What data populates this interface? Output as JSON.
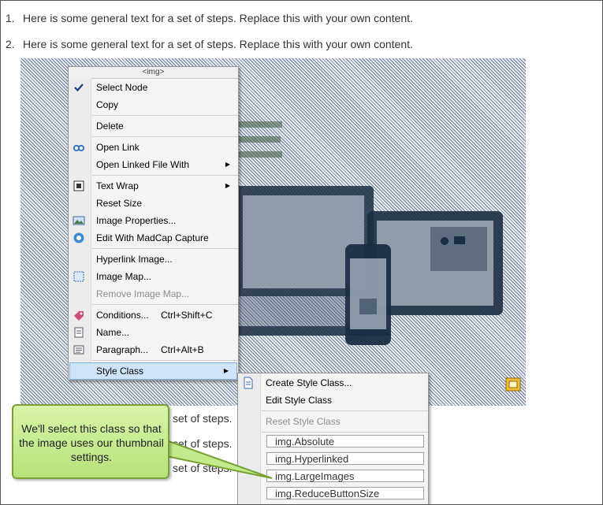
{
  "steps": [
    {
      "number": "1.",
      "text": "Here is some general text for a set of steps. Replace this with your own content."
    },
    {
      "number": "2.",
      "text": "Here is some general text for a set of steps. Replace this with your own content."
    }
  ],
  "partial_step_text": "set of steps.",
  "context_menu": {
    "header": "<img>",
    "items": {
      "select_node": "Select Node",
      "copy": "Copy",
      "delete": "Delete",
      "open_link": "Open Link",
      "open_linked_file_with": "Open Linked File With",
      "text_wrap": "Text Wrap",
      "reset_size": "Reset Size",
      "image_properties": "Image Properties...",
      "edit_with_madcap_capture": "Edit With MadCap Capture",
      "hyperlink_image": "Hyperlink Image...",
      "image_map": "Image Map...",
      "remove_image_map": "Remove Image Map...",
      "conditions": "Conditions...",
      "conditions_shortcut": "Ctrl+Shift+C",
      "name": "Name...",
      "paragraph": "Paragraph...",
      "paragraph_shortcut": "Ctrl+Alt+B",
      "style_class": "Style Class"
    }
  },
  "style_submenu": {
    "create_style_class": "Create Style Class...",
    "edit_style_class": "Edit Style Class",
    "reset_style_class": "Reset Style Class",
    "classes": [
      "img.Absolute",
      "img.Hyperlinked",
      "img.LargeImages",
      "img.ReduceButtonSize"
    ]
  },
  "callout": {
    "text": "We'll select this class so that the image uses our thumbnail settings."
  },
  "colors": {
    "callout_fill": "#c4ea8c",
    "menu_highlight": "#cfe3fb",
    "image_stripes": "#6f7d92"
  }
}
